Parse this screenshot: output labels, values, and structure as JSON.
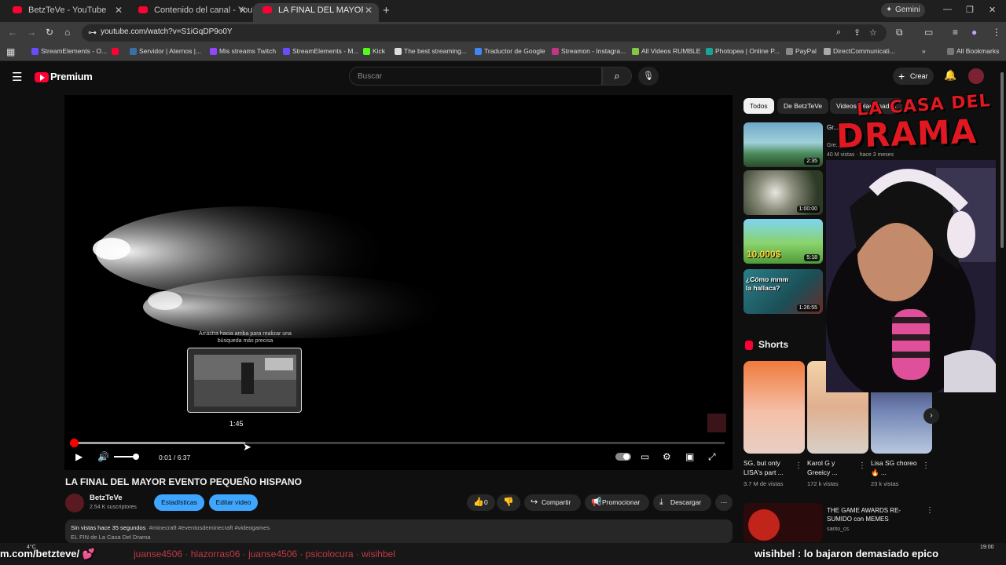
{
  "browser": {
    "tabs": [
      {
        "label": "BetzTeVe - YouTube",
        "active": false
      },
      {
        "label": "Contenido del canal - YouTube",
        "active": false
      },
      {
        "label": "LA FINAL DEL MAYOR EVENTO",
        "active": true
      }
    ],
    "new_tab": "+",
    "gemini_label": "Gemini",
    "url": "youtube.com/watch?v=S1iGqDP9o0Y",
    "bookmarks": [
      {
        "label": "StreamElements - O...",
        "color": "#6a4cff"
      },
      {
        "label": "",
        "color": "#ff0033"
      },
      {
        "label": "Servidor | Aternos |...",
        "color": "#3a6ea5"
      },
      {
        "label": "Mis streams Twitch",
        "color": "#9146ff"
      },
      {
        "label": "StreamElements - M...",
        "color": "#6a4cff"
      },
      {
        "label": "Kick",
        "color": "#53fc18"
      },
      {
        "label": "The best streaming...",
        "color": "#dddddd"
      },
      {
        "label": "Traductor de Google",
        "color": "#4285f4"
      },
      {
        "label": "Streamon - Instagra...",
        "color": "#c13584"
      },
      {
        "label": "All Videos RUMBLE",
        "color": "#85c742"
      },
      {
        "label": "Photopea | Online P...",
        "color": "#18a497"
      },
      {
        "label": "PayPal",
        "color": "#888888"
      },
      {
        "label": "DirectCommunicati...",
        "color": "#aaaaaa"
      }
    ],
    "all_bookmarks": "All Bookmarks"
  },
  "youtube": {
    "logo_text": "Premium",
    "search_placeholder": "Buscar",
    "create_label": "Crear"
  },
  "player": {
    "search_hint": "Arrastra hacia arriba para realizar una búsqueda más precisa",
    "preview_time": "1:45",
    "current_time": "0:01 / 6:37",
    "progress_played_fraction": 0.003,
    "hover_fraction": 0.265
  },
  "video": {
    "title": "LA FINAL DEL MAYOR EVENTO PEQUEÑO HISPANO",
    "channel": "BetzTeVe",
    "subscribers": "2.54 K suscriptores",
    "btn_stats": "Estadísticas",
    "btn_edit": "Editar video",
    "likes": "0",
    "share": "Compartir",
    "promote": "Promocionar",
    "download": "Descargar",
    "desc_meta": "Sin vistas  hace 35 segundos",
    "desc_tags": "#minecraft #eventosdeminecraft #videogames",
    "desc_line2": "EL FIN de La Casa Del Drama"
  },
  "sidebar": {
    "chips": [
      "Todos",
      "De BetzTeVe",
      "Videos relacionados"
    ],
    "videos": [
      {
        "duration": "2:35",
        "meta_title": "Gr...",
        "meta_ch": "Gre...",
        "meta_views": "40 M vistas · hace 3 meses"
      },
      {
        "duration": "1:00:00"
      },
      {
        "duration": "5:18",
        "overlay": "10.000$"
      },
      {
        "duration": "1:26:55",
        "overlay": "¿Cómo mmm la hallaca?"
      }
    ],
    "shorts_title": "Shorts",
    "shorts": [
      {
        "title": "SG, but only LISA's part ...",
        "views": "3.7 M de vistas"
      },
      {
        "title": "Karol G y Greeicy ...",
        "views": "172 k vistas"
      },
      {
        "title": "Lisa SG choreo 🔥 ...",
        "views": "23 k vistas"
      }
    ],
    "bottom_video": {
      "title": "THE GAME AWARDS RE-SUMIDO con MEMES",
      "channel": "santo_cs"
    }
  },
  "overlay": {
    "drama_top": "LA CASA DEL",
    "drama_bottom": "DRAMA"
  },
  "ticker": {
    "left": "m.com/betzteve/ 💕",
    "middle": "juanse4506 · hlazorras06 · juanse4506 · psicolocura · wisihbel",
    "right": "wisihbel : lo bajaron  demasiado epico"
  },
  "taskbar": {
    "temperature": "4°C",
    "clock": "19:00"
  },
  "colors": {
    "accent": "#ff0000",
    "blue": "#3ea6ff",
    "drama": "#e01822"
  }
}
